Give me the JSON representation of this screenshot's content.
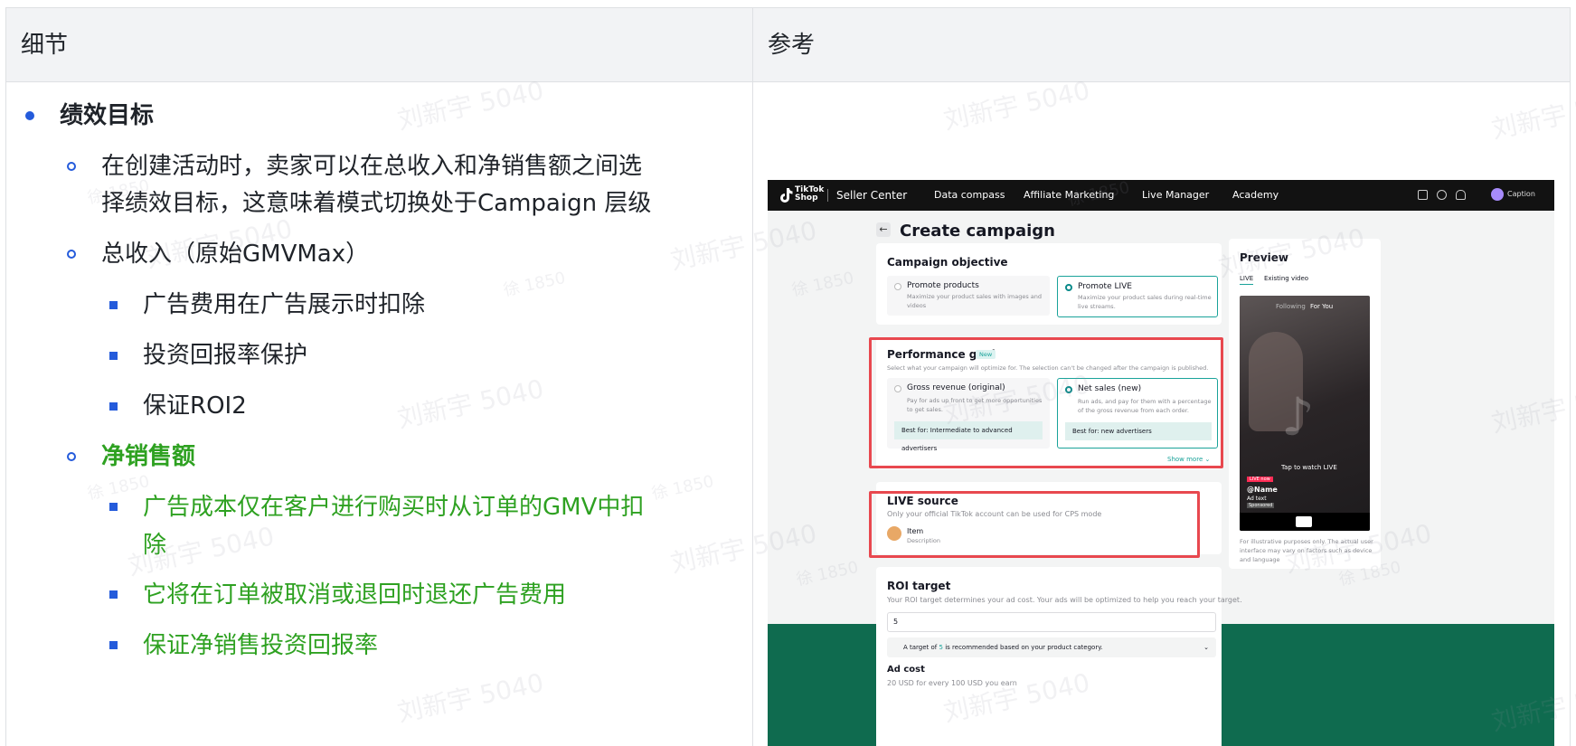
{
  "table": {
    "headers": [
      "细节",
      "参考"
    ]
  },
  "details": {
    "l1": "绩效目标",
    "l2_1": "在创建活动时，卖家可以在总收入和净销售额之间选",
    "l2_1b": "择绩效目标，这意味着模式切换处于Campaign  层级",
    "l2_2": "总收入（原始GMVMax）",
    "l3_1": "广告费用在广告展示时扣除",
    "l3_2": "投资回报率保护",
    "l3_3": "保证ROI2",
    "l2_3": "净销售额",
    "l3_4": "广告成本仅在客户进行购买时从订单的GMV中扣",
    "l3_4b": "除",
    "l3_5": "它将在订单被取消或退回时退还广告费用",
    "l3_6": "保证净销售投资回报率"
  },
  "watermarks": {
    "main": "刘新宇 5040",
    "small": "徐 1850"
  },
  "screenshot": {
    "nav": {
      "logo_line1": "TikTok",
      "logo_line2": "Shop",
      "items": [
        "Seller Center",
        "Data compass",
        "Affiliate Marketing",
        "Live Manager",
        "Academy"
      ],
      "account": "Caption"
    },
    "page_title": "Create campaign",
    "objective": {
      "title": "Campaign objective",
      "opt1_title": "Promote products",
      "opt1_desc": "Maximize your product sales with images and videos",
      "opt2_title": "Promote LIVE",
      "opt2_desc": "Maximize your product sales during real-time live streams."
    },
    "goal": {
      "title": "Performance goal",
      "badge": "New",
      "sub": "Select what your campaign will optimize for. The selection can't be changed after the campaign is published.",
      "opt1_title": "Gross revenue (original)",
      "opt1_desc": "Pay for ads up front to get more opportunities to get sales.",
      "opt1_best": "Best for: Intermediate to advanced advertisers",
      "opt2_title": "Net sales (new)",
      "opt2_desc": "Run ads, and pay for them with a percentage of the gross revenue from each order.",
      "opt2_best": "Best for: new advertisers",
      "show_more": "Show more"
    },
    "live_source": {
      "title": "LIVE source",
      "sub": "Only your official TikTok account can be used for CPS mode",
      "item_title": "Item",
      "item_desc": "Description"
    },
    "roi": {
      "title": "ROI target",
      "sub": "Your ROI target determines your ad cost. Your ads will be optimized to help you reach your target.",
      "input_value": "5",
      "hint_pre": "A target of",
      "hint_num": "5",
      "hint_post": "is recommended based on your product category.",
      "adcost_title": "Ad cost",
      "adcost_sub": "20 USD for every 100 USD you earn"
    },
    "preview": {
      "title": "Preview",
      "tab1": "LIVE",
      "tab2": "Existing video",
      "top_following": "Following",
      "top_foryou": "For You",
      "tap": "Tap to watch LIVE",
      "live_badge": "LIVE now",
      "name": "@Name",
      "ad_text": "Ad text",
      "sponsored": "Sponsored",
      "disclaimer": "For illustrative purposes only. The actual user interface may vary on factors such as device and language"
    }
  },
  "colors": {
    "bullet": "#245bdb",
    "green_text": "#2ea121",
    "highlight_box": "#e8484f",
    "nav_bg": "#121212",
    "band": "#0f6b4f"
  }
}
